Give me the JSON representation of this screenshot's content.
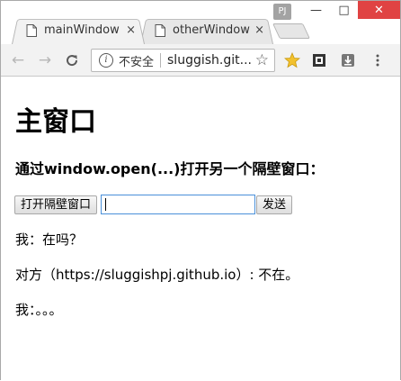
{
  "browser": {
    "tabs": [
      {
        "title": "mainWindow",
        "close": "×"
      },
      {
        "title": "otherWindow",
        "close": "×"
      }
    ],
    "profile_badge": "PJ",
    "controls": {
      "minimize": "—",
      "maximize": "□",
      "close": "✕"
    },
    "nav": {
      "back": "←",
      "forward": "→",
      "reload": "C"
    },
    "omnibox": {
      "info_icon": "i",
      "security_label": "不安全",
      "url": "sluggish.git...",
      "bookmark_icon": "☆"
    },
    "icons": [
      "page-icon",
      "star-extension-icon",
      "screen-icon",
      "download-icon",
      "menu-icon"
    ]
  },
  "page": {
    "title": "主窗口",
    "subtitle": "通过window.open(...)打开另一个隔壁窗口：",
    "open_button": "打开隔壁窗口",
    "input_value": "",
    "send_button": "发送",
    "messages": [
      "我：在吗？",
      "对方（https://sluggishpj.github.io）: 不在。",
      "我：。。。"
    ]
  },
  "colors": {
    "close_button": "#e04343",
    "input_focus": "#4a90d9",
    "toolbar": "#f2f2f2"
  }
}
